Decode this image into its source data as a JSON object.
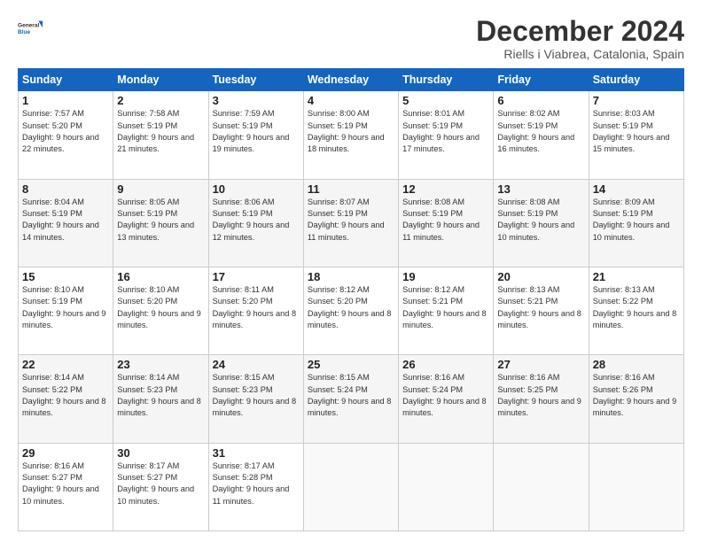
{
  "logo": {
    "line1": "General",
    "line2": "Blue"
  },
  "header": {
    "title": "December 2024",
    "location": "Riells i Viabrea, Catalonia, Spain"
  },
  "weekdays": [
    "Sunday",
    "Monday",
    "Tuesday",
    "Wednesday",
    "Thursday",
    "Friday",
    "Saturday"
  ],
  "weeks": [
    [
      {
        "day": 1,
        "sunrise": "7:57 AM",
        "sunset": "5:20 PM",
        "daylight": "9 hours and 22 minutes."
      },
      {
        "day": 2,
        "sunrise": "7:58 AM",
        "sunset": "5:19 PM",
        "daylight": "9 hours and 21 minutes."
      },
      {
        "day": 3,
        "sunrise": "7:59 AM",
        "sunset": "5:19 PM",
        "daylight": "9 hours and 19 minutes."
      },
      {
        "day": 4,
        "sunrise": "8:00 AM",
        "sunset": "5:19 PM",
        "daylight": "9 hours and 18 minutes."
      },
      {
        "day": 5,
        "sunrise": "8:01 AM",
        "sunset": "5:19 PM",
        "daylight": "9 hours and 17 minutes."
      },
      {
        "day": 6,
        "sunrise": "8:02 AM",
        "sunset": "5:19 PM",
        "daylight": "9 hours and 16 minutes."
      },
      {
        "day": 7,
        "sunrise": "8:03 AM",
        "sunset": "5:19 PM",
        "daylight": "9 hours and 15 minutes."
      }
    ],
    [
      {
        "day": 8,
        "sunrise": "8:04 AM",
        "sunset": "5:19 PM",
        "daylight": "9 hours and 14 minutes."
      },
      {
        "day": 9,
        "sunrise": "8:05 AM",
        "sunset": "5:19 PM",
        "daylight": "9 hours and 13 minutes."
      },
      {
        "day": 10,
        "sunrise": "8:06 AM",
        "sunset": "5:19 PM",
        "daylight": "9 hours and 12 minutes."
      },
      {
        "day": 11,
        "sunrise": "8:07 AM",
        "sunset": "5:19 PM",
        "daylight": "9 hours and 11 minutes."
      },
      {
        "day": 12,
        "sunrise": "8:08 AM",
        "sunset": "5:19 PM",
        "daylight": "9 hours and 11 minutes."
      },
      {
        "day": 13,
        "sunrise": "8:08 AM",
        "sunset": "5:19 PM",
        "daylight": "9 hours and 10 minutes."
      },
      {
        "day": 14,
        "sunrise": "8:09 AM",
        "sunset": "5:19 PM",
        "daylight": "9 hours and 10 minutes."
      }
    ],
    [
      {
        "day": 15,
        "sunrise": "8:10 AM",
        "sunset": "5:19 PM",
        "daylight": "9 hours and 9 minutes."
      },
      {
        "day": 16,
        "sunrise": "8:10 AM",
        "sunset": "5:20 PM",
        "daylight": "9 hours and 9 minutes."
      },
      {
        "day": 17,
        "sunrise": "8:11 AM",
        "sunset": "5:20 PM",
        "daylight": "9 hours and 8 minutes."
      },
      {
        "day": 18,
        "sunrise": "8:12 AM",
        "sunset": "5:20 PM",
        "daylight": "9 hours and 8 minutes."
      },
      {
        "day": 19,
        "sunrise": "8:12 AM",
        "sunset": "5:21 PM",
        "daylight": "9 hours and 8 minutes."
      },
      {
        "day": 20,
        "sunrise": "8:13 AM",
        "sunset": "5:21 PM",
        "daylight": "9 hours and 8 minutes."
      },
      {
        "day": 21,
        "sunrise": "8:13 AM",
        "sunset": "5:22 PM",
        "daylight": "9 hours and 8 minutes."
      }
    ],
    [
      {
        "day": 22,
        "sunrise": "8:14 AM",
        "sunset": "5:22 PM",
        "daylight": "9 hours and 8 minutes."
      },
      {
        "day": 23,
        "sunrise": "8:14 AM",
        "sunset": "5:23 PM",
        "daylight": "9 hours and 8 minutes."
      },
      {
        "day": 24,
        "sunrise": "8:15 AM",
        "sunset": "5:23 PM",
        "daylight": "9 hours and 8 minutes."
      },
      {
        "day": 25,
        "sunrise": "8:15 AM",
        "sunset": "5:24 PM",
        "daylight": "9 hours and 8 minutes."
      },
      {
        "day": 26,
        "sunrise": "8:16 AM",
        "sunset": "5:24 PM",
        "daylight": "9 hours and 8 minutes."
      },
      {
        "day": 27,
        "sunrise": "8:16 AM",
        "sunset": "5:25 PM",
        "daylight": "9 hours and 9 minutes."
      },
      {
        "day": 28,
        "sunrise": "8:16 AM",
        "sunset": "5:26 PM",
        "daylight": "9 hours and 9 minutes."
      }
    ],
    [
      {
        "day": 29,
        "sunrise": "8:16 AM",
        "sunset": "5:27 PM",
        "daylight": "9 hours and 10 minutes."
      },
      {
        "day": 30,
        "sunrise": "8:17 AM",
        "sunset": "5:27 PM",
        "daylight": "9 hours and 10 minutes."
      },
      {
        "day": 31,
        "sunrise": "8:17 AM",
        "sunset": "5:28 PM",
        "daylight": "9 hours and 11 minutes."
      },
      null,
      null,
      null,
      null
    ]
  ]
}
